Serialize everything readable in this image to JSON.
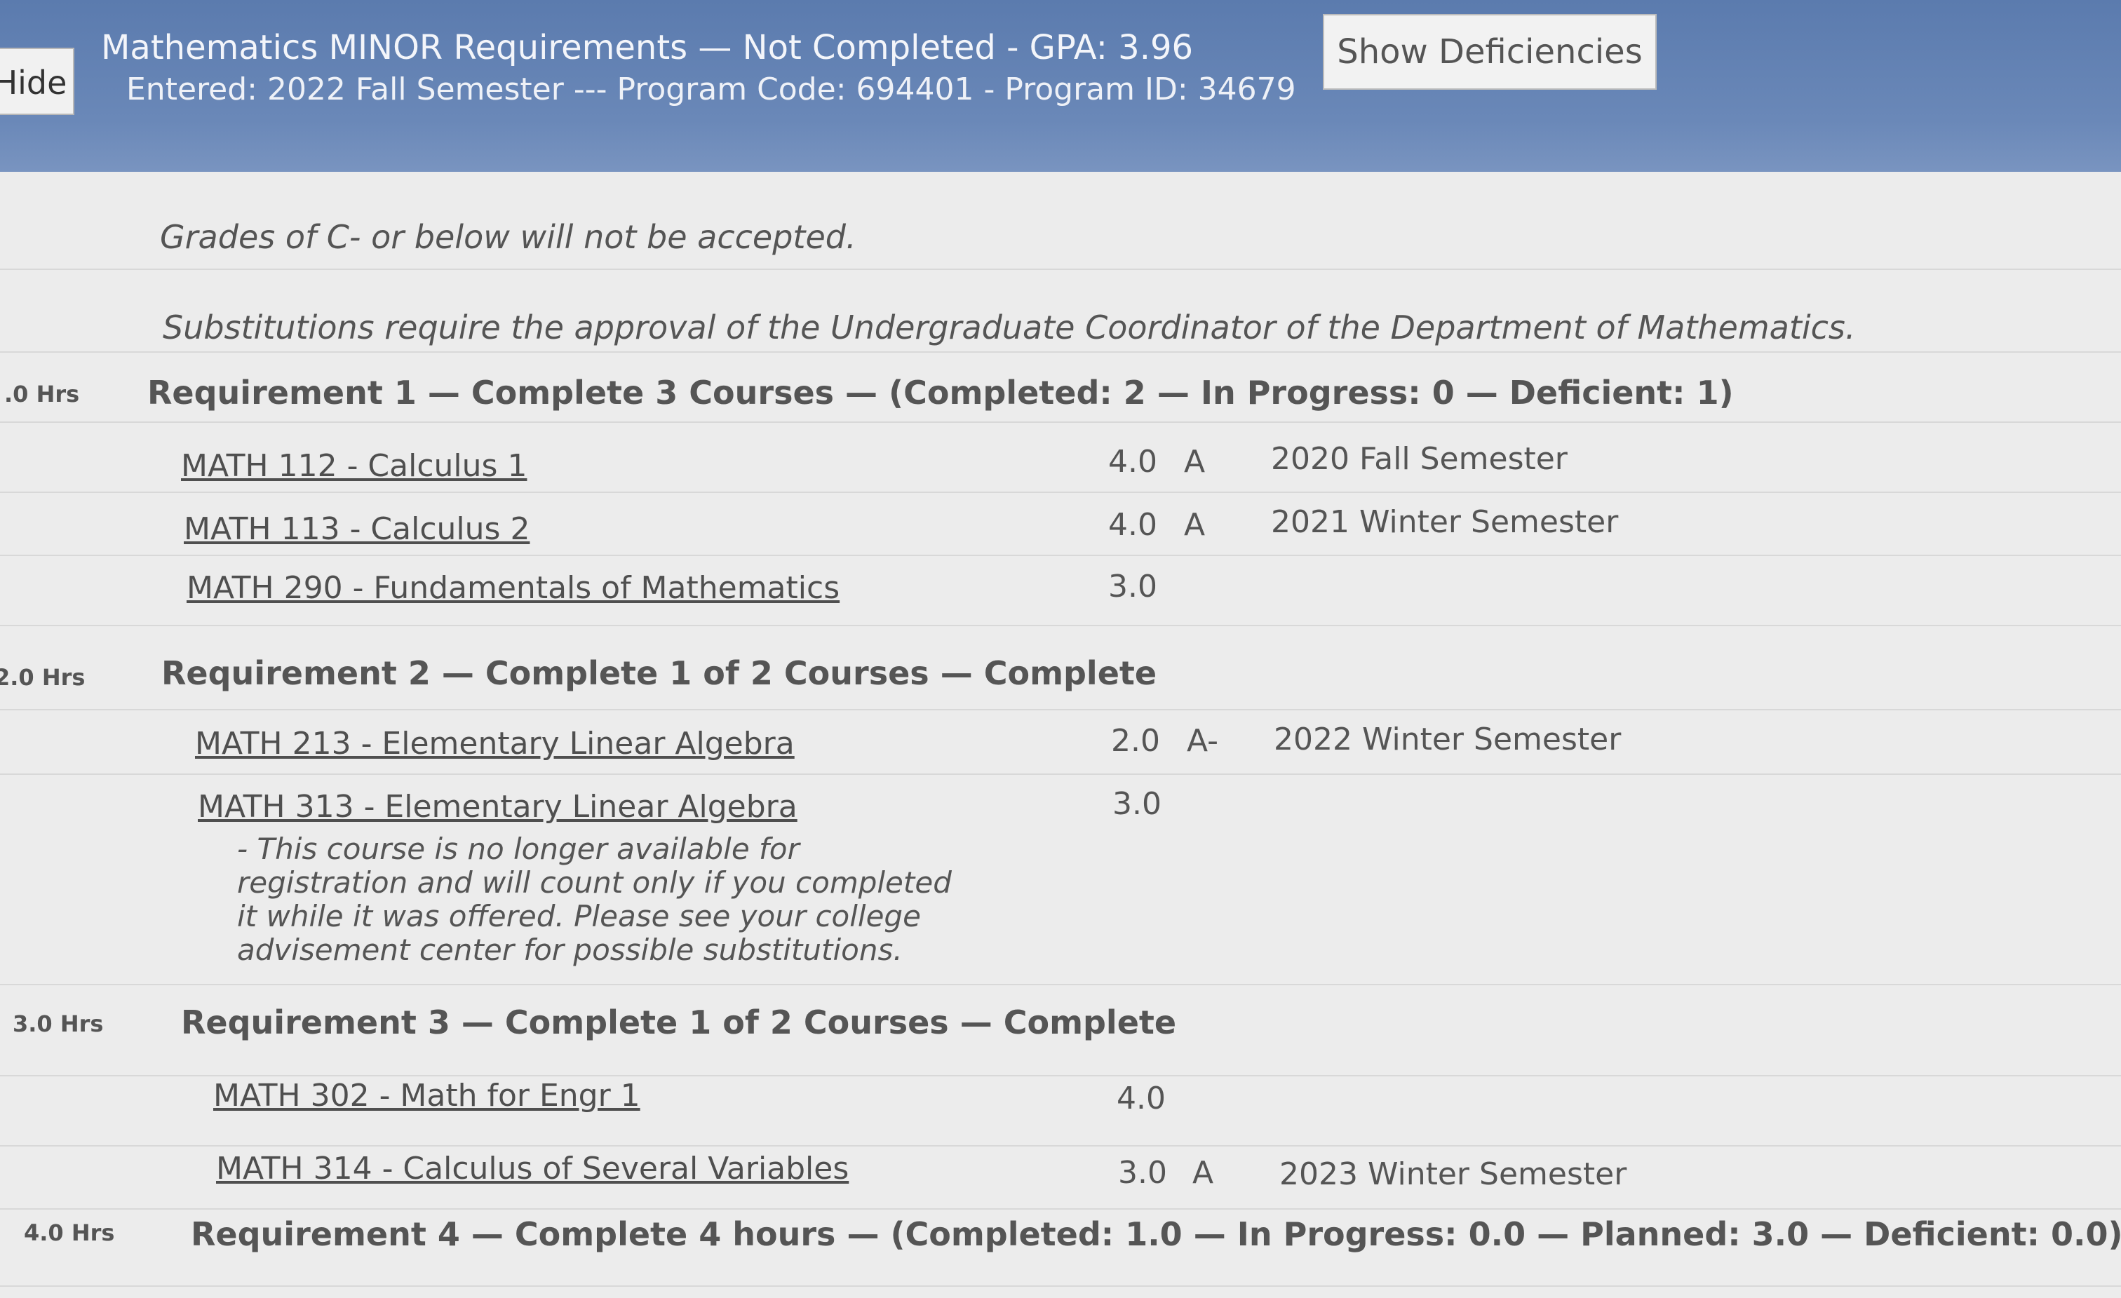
{
  "header": {
    "hide_label": "Hide",
    "title": "Mathematics MINOR Requirements — Not Completed - GPA: 3.96",
    "subtitle": "Entered: 2022 Fall Semester --- Program Code: 694401 - Program ID: 34679",
    "show_deficiencies_label": "Show Deficiencies"
  },
  "notes": [
    "Grades of C- or below will not be accepted.",
    "Substitutions require the approval of the Undergraduate Coordinator of the Department of Mathematics."
  ],
  "requirements": [
    {
      "hours": ".0 Hrs",
      "title": "Requirement 1 —  Complete 3 Courses — (Completed: 2 — In Progress: 0 — Deficient: 1)",
      "courses": [
        {
          "name": "MATH 112 - Calculus 1",
          "credits": "4.0",
          "grade": "A",
          "term": "2020 Fall Semester"
        },
        {
          "name": "MATH 113 - Calculus 2",
          "credits": "4.0",
          "grade": "A",
          "term": "2021 Winter Semester"
        },
        {
          "name": "MATH 290 - Fundamentals of Mathematics",
          "credits": "3.0",
          "grade": "",
          "term": ""
        }
      ]
    },
    {
      "hours": "2.0 Hrs",
      "title": "Requirement 2 —  Complete 1 of 2 Courses — Complete",
      "courses": [
        {
          "name": "MATH 213 - Elementary Linear Algebra",
          "credits": "2.0",
          "grade": "A-",
          "term": "2022 Winter Semester"
        },
        {
          "name": "MATH 313 - Elementary Linear Algebra",
          "credits": "3.0",
          "grade": "",
          "term": "",
          "note": "- This course is no longer available for\nregistration and will count only if you completed\nit while it was offered. Please see your college\nadvisement center for possible substitutions."
        }
      ]
    },
    {
      "hours": "3.0 Hrs",
      "title": "Requirement 3 —  Complete 1 of 2 Courses — Complete",
      "courses": [
        {
          "name": "MATH 302 - Math for Engr 1",
          "credits": "4.0",
          "grade": "",
          "term": ""
        },
        {
          "name": "MATH 314 - Calculus of Several Variables",
          "credits": "3.0",
          "grade": "A",
          "term": "2023 Winter Semester"
        }
      ]
    },
    {
      "hours": "4.0 Hrs",
      "title": "Requirement 4 —  Complete 4 hours — (Completed: 1.0 — In Progress: 0.0 — Planned: 3.0 — Deficient: 0.0)"
    }
  ]
}
